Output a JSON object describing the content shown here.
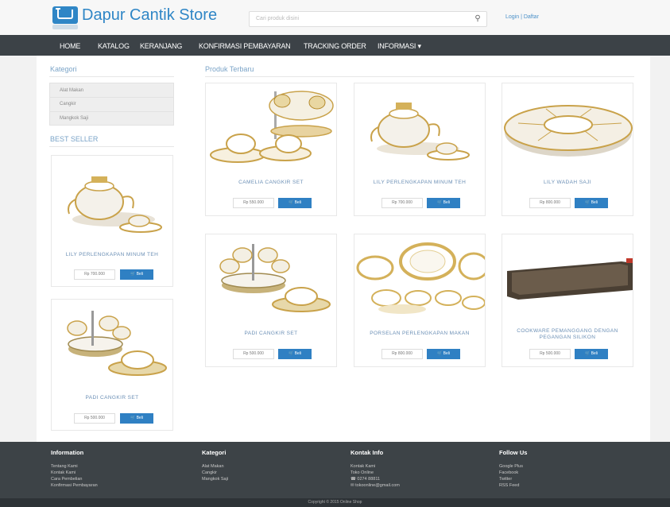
{
  "header": {
    "store_name": "Dapur Cantik Store",
    "search_placeholder": "Cari produk disini",
    "login": "Login | Daftar"
  },
  "nav": [
    "HOME",
    "KATALOG",
    "KERANJANG",
    "KONFIRMASI PEMBAYARAN",
    "TRACKING ORDER",
    "INFORMASI ▾"
  ],
  "sidebar": {
    "kategori_title": "Kategori",
    "categories": [
      "Alat Makan",
      "Cangkir",
      "Mangkok Saji"
    ],
    "best_seller_title": "BEST SELLER",
    "best_sellers": [
      {
        "name": "LILY PERLENGKAPAN MINUM TEH",
        "price": "Rp 700.000",
        "buy": "Beli"
      },
      {
        "name": "PADI CANGKIR SET",
        "price": "Rp 500.000",
        "buy": "Beli"
      }
    ]
  },
  "main": {
    "title": "Produk Terbaru",
    "products": [
      {
        "name": "CAMELIA CANGKIR SET",
        "price": "Rp 550.000",
        "buy": "Beli"
      },
      {
        "name": "LILY PERLENGKAPAN MINUM TEH",
        "price": "Rp 700.000",
        "buy": "Beli"
      },
      {
        "name": "LILY WADAH SAJI",
        "price": "Rp 800.000",
        "buy": "Beli"
      },
      {
        "name": "PADI CANGKIR SET",
        "price": "Rp 500.000",
        "buy": "Beli"
      },
      {
        "name": "PORSELAN PERLENGKAPAN MAKAN",
        "price": "Rp 800.000",
        "buy": "Beli"
      },
      {
        "name": "COOKWARE PEMANGGANG DENGAN PEGANGAN SILIKON",
        "price": "Rp 500.000",
        "buy": "Beli"
      }
    ]
  },
  "footer": {
    "columns": [
      {
        "title": "Information",
        "items": [
          "Tentang Kami",
          "Kontak Kami",
          "Cara Pembelian",
          "Konfirmasi Pembayaran"
        ]
      },
      {
        "title": "Kategori",
        "items": [
          "Alat Makan",
          "Cangkir",
          "Mangkok Saji"
        ]
      },
      {
        "title": "Kontak Info",
        "items": [
          "Kontak Kami",
          "Toko Online",
          "☎ 0274 88811",
          "✉ tokoonline@gmail.com"
        ]
      },
      {
        "title": "Follow Us",
        "items": [
          "Google Plus",
          "Facebook",
          "Twitter",
          "RSS Feed"
        ]
      }
    ],
    "copyright": "Copyright © 2015 Online Shop"
  },
  "colors": {
    "accent": "#2f80c3",
    "nav_bg": "#3c4247",
    "footer_bg": "#3d4347"
  }
}
